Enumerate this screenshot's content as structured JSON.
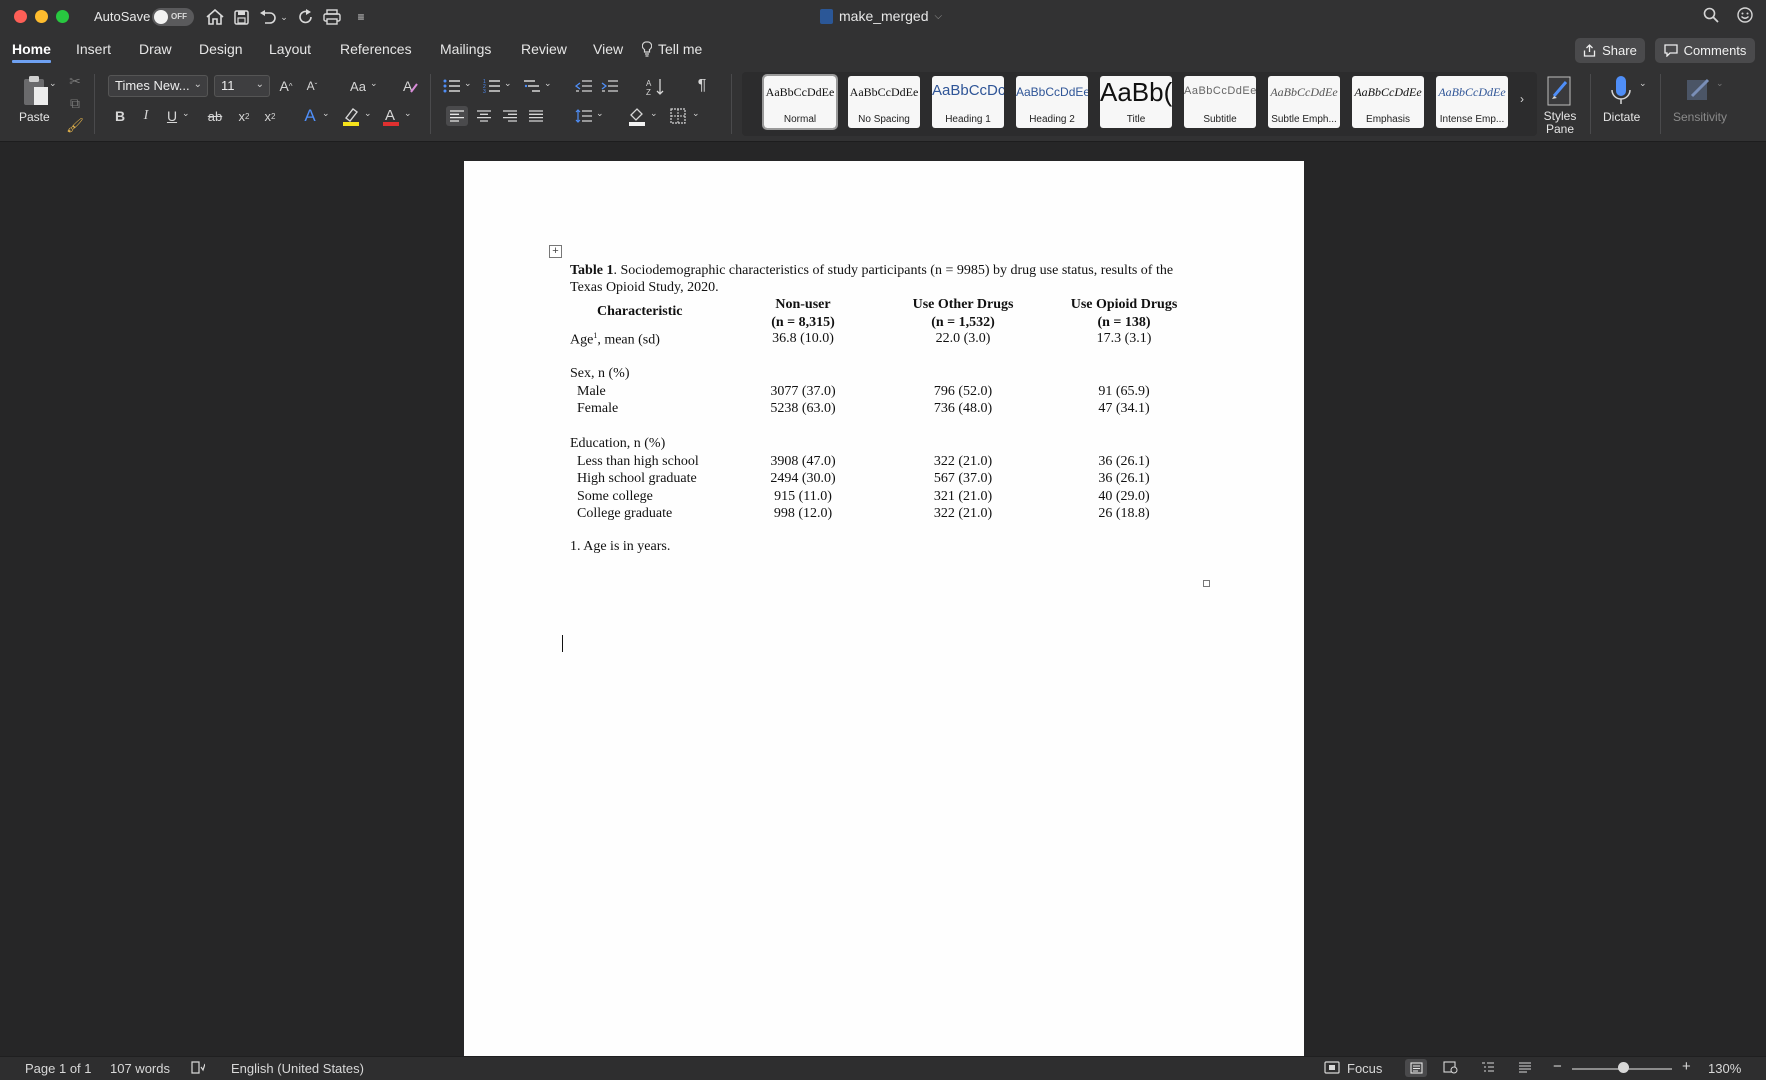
{
  "titlebar": {
    "autosave_label": "AutoSave",
    "autosave_state": "OFF",
    "doc_title": "make_merged",
    "title_caret": "⌵"
  },
  "tabs": [
    "Home",
    "Insert",
    "Draw",
    "Design",
    "Layout",
    "References",
    "Mailings",
    "Review",
    "View"
  ],
  "tell_me": "Tell me",
  "share_label": "Share",
  "comments_label": "Comments",
  "ribbon": {
    "paste_label": "Paste",
    "font_name": "Times New...",
    "font_size": "11",
    "styles": [
      {
        "sample": "AaBbCcDdEe",
        "name": "Normal"
      },
      {
        "sample": "AaBbCcDdEe",
        "name": "No Spacing"
      },
      {
        "sample": "AaBbCcDc",
        "name": "Heading 1"
      },
      {
        "sample": "AaBbCcDdEe",
        "name": "Heading 2"
      },
      {
        "sample": "AaBb(",
        "name": "Title"
      },
      {
        "sample": "AaBbCcDdEe",
        "name": "Subtitle"
      },
      {
        "sample": "AaBbCcDdEe",
        "name": "Subtle Emph..."
      },
      {
        "sample": "AaBbCcDdEe",
        "name": "Emphasis"
      },
      {
        "sample": "AaBbCcDdEe",
        "name": "Intense Emp..."
      }
    ],
    "styles_pane_label": "Styles Pane",
    "dictate_label": "Dictate",
    "sensitivity_label": "Sensitivity"
  },
  "document": {
    "caption_bold": "Table 1",
    "caption_text": ". Sociodemographic characteristics of study participants (n = 9985) by drug use status, results of the Texas Opioid Study, 2020.",
    "table": {
      "headers": [
        {
          "line1": "Characteristic",
          "line2": ""
        },
        {
          "line1": "Non-user",
          "line2": "(n = 8,315)"
        },
        {
          "line1": "Use Other Drugs",
          "line2": "(n = 1,532)"
        },
        {
          "line1": "Use Opioid Drugs",
          "line2": "(n = 138)"
        }
      ],
      "age_row": {
        "label": "Age",
        "sup": "1",
        "label_rest": ", mean (sd)",
        "values": [
          "36.8 (10.0)",
          "22.0 (3.0)",
          "17.3 (3.1)"
        ]
      },
      "sex_header": "Sex, n (%)",
      "sex_rows": [
        {
          "label": "Male",
          "values": [
            "3077 (37.0)",
            "796 (52.0)",
            "91 (65.9)"
          ]
        },
        {
          "label": "Female",
          "values": [
            "5238 (63.0)",
            "736 (48.0)",
            "47 (34.1)"
          ]
        }
      ],
      "edu_header": "Education, n (%)",
      "edu_rows": [
        {
          "label": "Less than high school",
          "values": [
            "3908 (47.0)",
            "322 (21.0)",
            "36 (26.1)"
          ]
        },
        {
          "label": "High school graduate",
          "values": [
            "2494 (30.0)",
            "567 (37.0)",
            "36 (26.1)"
          ]
        },
        {
          "label": "Some college",
          "values": [
            "915 (11.0)",
            "321 (21.0)",
            "40 (29.0)"
          ]
        },
        {
          "label": "College graduate",
          "values": [
            "998 (12.0)",
            "322 (21.0)",
            "26 (18.8)"
          ]
        }
      ]
    },
    "footnote": "1. Age is in years."
  },
  "statusbar": {
    "page": "Page 1 of 1",
    "words": "107 words",
    "language": "English (United States)",
    "focus": "Focus",
    "zoom": "130%"
  }
}
